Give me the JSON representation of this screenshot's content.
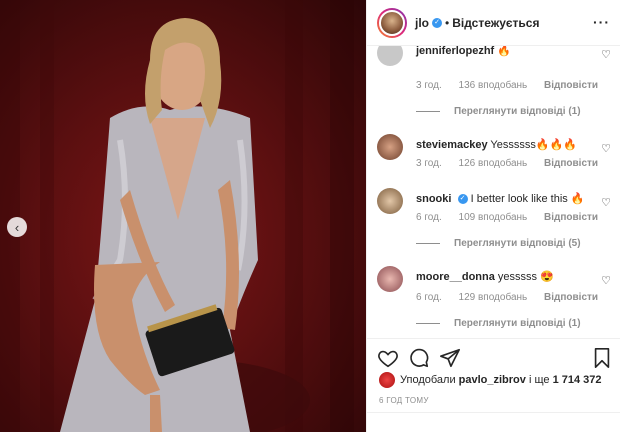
{
  "post": {
    "username": "jlo",
    "follow_status": "Відстежується",
    "likes": {
      "prefix": "Уподобали",
      "user": "pavlo_zibrov",
      "middle": "і ще",
      "count": "1 714 372"
    },
    "timestamp": "6 ГОД ТОМУ"
  },
  "comments": [
    {
      "user": "jenniferlopezhf",
      "text": "🔥",
      "time": "3 год.",
      "likes": "136 вподобань",
      "reply_label": "Відповісти",
      "view_replies": "Переглянути відповіді (1)"
    },
    {
      "user": "steviemackey",
      "text": "Yessssss🔥🔥🔥",
      "time": "3 год.",
      "likes": "126 вподобань",
      "reply_label": "Відповісти"
    },
    {
      "user": "snooki",
      "text": "I better look like this 🔥",
      "time": "6 год.",
      "likes": "109 вподобань",
      "reply_label": "Відповісти",
      "view_replies": "Переглянути відповіді (5)"
    },
    {
      "user": "moore__donna",
      "text": "yesssss 😍",
      "time": "6 год.",
      "likes": "129 вподобань",
      "reply_label": "Відповісти",
      "view_replies": "Переглянути відповіді (1)"
    }
  ],
  "colors": {
    "verified": "#3897f0",
    "backdrop": "#6b1214",
    "meta": "#8e8e8e"
  },
  "icons": [
    "chevron-left-icon",
    "more-icon",
    "heart-icon",
    "comment-icon",
    "share-icon",
    "bookmark-icon"
  ]
}
